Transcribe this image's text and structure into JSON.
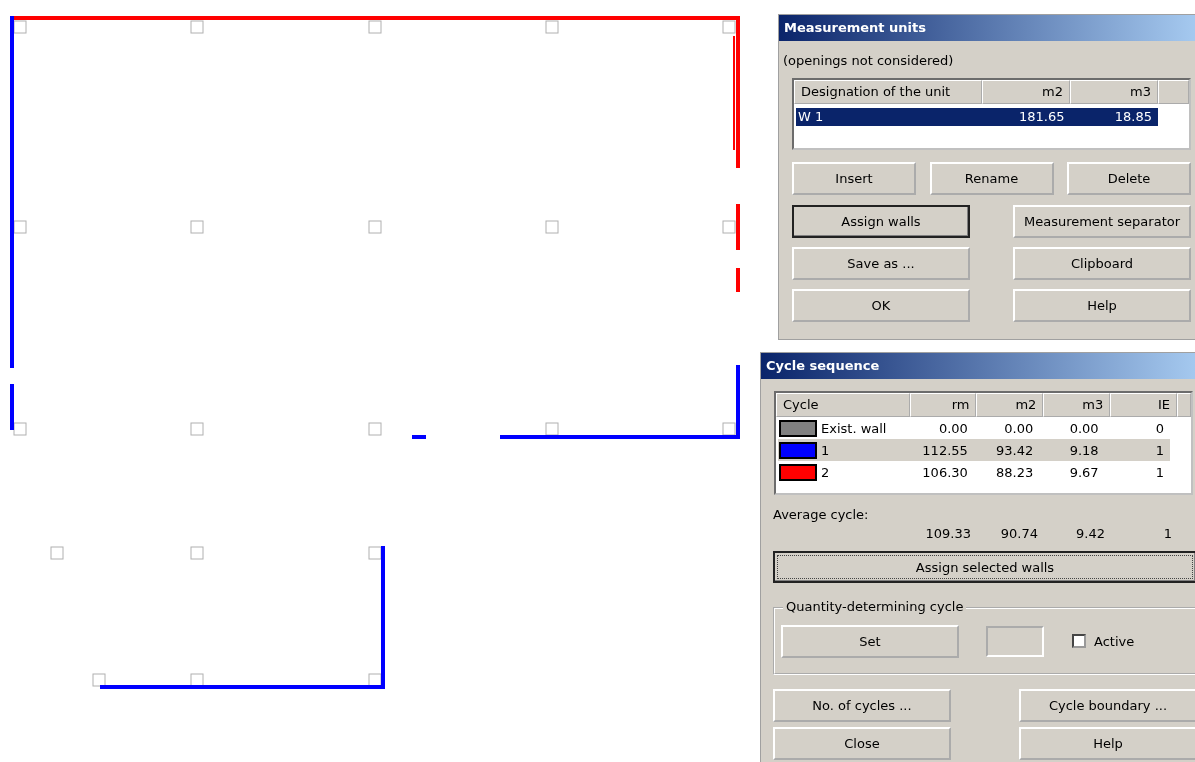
{
  "units_dialog": {
    "title": "Measurement units",
    "note": "(openings not considered)",
    "columns": [
      "Designation of the unit",
      "m2",
      "m3"
    ],
    "rows": [
      {
        "name": "W 1",
        "m2": "181.65",
        "m3": "18.85",
        "selected": true
      }
    ],
    "buttons": [
      {
        "label": "Insert",
        "default": false
      },
      {
        "label": "Rename",
        "default": false
      },
      {
        "label": "Delete",
        "default": false
      },
      {
        "label": "Assign walls",
        "default": true
      },
      {
        "label": "Measurement separator",
        "default": false
      },
      {
        "label": "Save as ...",
        "default": false
      },
      {
        "label": "Clipboard",
        "default": false
      },
      {
        "label": "OK",
        "default": false
      },
      {
        "label": "Help",
        "default": false
      }
    ]
  },
  "cycle_dialog": {
    "title": "Cycle sequence",
    "columns": [
      "Cycle",
      "rm",
      "m2",
      "m3",
      "IE"
    ],
    "rows": [
      {
        "name": "Exist. wall",
        "color": "#808080",
        "rm": "0.00",
        "m2": "0.00",
        "m3": "0.00",
        "ie": "0",
        "selected": false
      },
      {
        "name": "1",
        "color": "#0000ff",
        "rm": "112.55",
        "m2": "93.42",
        "m3": "9.18",
        "ie": "1",
        "selected": true
      },
      {
        "name": "2",
        "color": "#ff0000",
        "rm": "106.30",
        "m2": "88.23",
        "m3": "9.67",
        "ie": "1",
        "selected": false
      }
    ],
    "average_label": "Average cycle:",
    "average": [
      "109.33",
      "90.74",
      "9.42",
      "1"
    ],
    "assign_button": "Assign selected walls",
    "group_title": "Quantity-determining cycle",
    "set_button": "Set",
    "active": {
      "label": "Active",
      "checked": false
    },
    "buttons": [
      "No. of cycles ...",
      "Cycle boundary ...",
      "Close",
      "Help"
    ]
  }
}
